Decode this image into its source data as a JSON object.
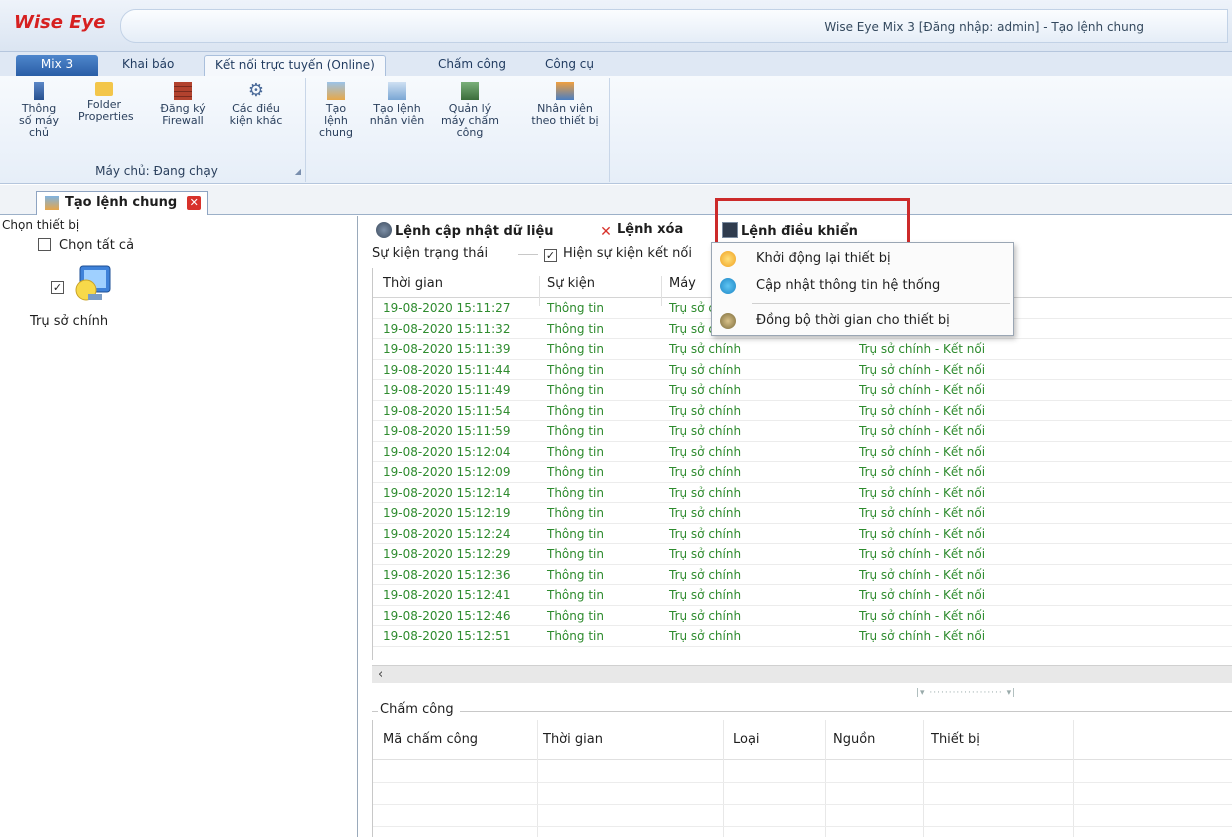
{
  "app": {
    "logo_text": "Wise Eye",
    "window_title": "Wise Eye Mix 3 [Đăng nhập: admin] - Tạo lệnh chung"
  },
  "ribbon_tabs": [
    "Mix 3",
    "Khai báo",
    "Kết nối trực tuyến (Online)",
    "Chấm công",
    "Công cụ"
  ],
  "ribbon": {
    "group1": {
      "buttons": [
        "Thông số máy chủ",
        "Folder Properties",
        "Đăng ký Firewall",
        "Các điều kiện khác"
      ],
      "label": "Máy chủ: Đang chạy"
    },
    "group2": {
      "buttons": [
        "Tạo lệnh chung",
        "Tạo lệnh nhân viên",
        "Quản lý máy chấm công",
        "Nhân viên theo thiết bị"
      ]
    }
  },
  "doc_tab": {
    "label": "Tạo lệnh chung"
  },
  "left_panel": {
    "title": "Chọn thiết bị",
    "select_all": "Chọn tất cả",
    "device_name": "Trụ sở chính"
  },
  "commands": {
    "update": "Lệnh cập nhật dữ liệu",
    "delete": "Lệnh xóa",
    "control": "Lệnh điều khiển"
  },
  "control_menu": [
    "Khởi động lại thiết bị",
    "Cập nhật thông tin hệ thống",
    "Đồng bộ thời gian cho thiết bị"
  ],
  "events": {
    "group_label": "Sự kiện trạng thái",
    "show_connect": "Hiện sự kiện kết nối",
    "columns": [
      "Thời gian",
      "Sự kiện",
      "Máy"
    ],
    "rows": [
      {
        "time": "19-08-2020 15:11:27",
        "event": "Thông tin",
        "machine": "Trụ sở chính",
        "desc": ""
      },
      {
        "time": "19-08-2020 15:11:32",
        "event": "Thông tin",
        "machine": "Trụ sở chính",
        "desc": ""
      },
      {
        "time": "19-08-2020 15:11:39",
        "event": "Thông tin",
        "machine": "Trụ sở chính",
        "desc": "Trụ sở chính - Kết nối"
      },
      {
        "time": "19-08-2020 15:11:44",
        "event": "Thông tin",
        "machine": "Trụ sở chính",
        "desc": "Trụ sở chính - Kết nối"
      },
      {
        "time": "19-08-2020 15:11:49",
        "event": "Thông tin",
        "machine": "Trụ sở chính",
        "desc": "Trụ sở chính - Kết nối"
      },
      {
        "time": "19-08-2020 15:11:54",
        "event": "Thông tin",
        "machine": "Trụ sở chính",
        "desc": "Trụ sở chính - Kết nối"
      },
      {
        "time": "19-08-2020 15:11:59",
        "event": "Thông tin",
        "machine": "Trụ sở chính",
        "desc": "Trụ sở chính - Kết nối"
      },
      {
        "time": "19-08-2020 15:12:04",
        "event": "Thông tin",
        "machine": "Trụ sở chính",
        "desc": "Trụ sở chính - Kết nối"
      },
      {
        "time": "19-08-2020 15:12:09",
        "event": "Thông tin",
        "machine": "Trụ sở chính",
        "desc": "Trụ sở chính - Kết nối"
      },
      {
        "time": "19-08-2020 15:12:14",
        "event": "Thông tin",
        "machine": "Trụ sở chính",
        "desc": "Trụ sở chính - Kết nối"
      },
      {
        "time": "19-08-2020 15:12:19",
        "event": "Thông tin",
        "machine": "Trụ sở chính",
        "desc": "Trụ sở chính - Kết nối"
      },
      {
        "time": "19-08-2020 15:12:24",
        "event": "Thông tin",
        "machine": "Trụ sở chính",
        "desc": "Trụ sở chính - Kết nối"
      },
      {
        "time": "19-08-2020 15:12:29",
        "event": "Thông tin",
        "machine": "Trụ sở chính",
        "desc": "Trụ sở chính - Kết nối"
      },
      {
        "time": "19-08-2020 15:12:36",
        "event": "Thông tin",
        "machine": "Trụ sở chính",
        "desc": "Trụ sở chính - Kết nối"
      },
      {
        "time": "19-08-2020 15:12:41",
        "event": "Thông tin",
        "machine": "Trụ sở chính",
        "desc": "Trụ sở chính - Kết nối"
      },
      {
        "time": "19-08-2020 15:12:46",
        "event": "Thông tin",
        "machine": "Trụ sở chính",
        "desc": "Trụ sở chính - Kết nối"
      },
      {
        "time": "19-08-2020 15:12:51",
        "event": "Thông tin",
        "machine": "Trụ sở chính",
        "desc": "Trụ sở chính - Kết nối"
      }
    ]
  },
  "attendance": {
    "group_label": "Chấm công",
    "columns": [
      "Mã chấm công",
      "Thời gian",
      "Loại",
      "Nguồn",
      "Thiết bị"
    ]
  },
  "colors": {
    "event_text": "#2e8b2e",
    "highlight": "#cc2a2a",
    "close": "#d8322b"
  }
}
